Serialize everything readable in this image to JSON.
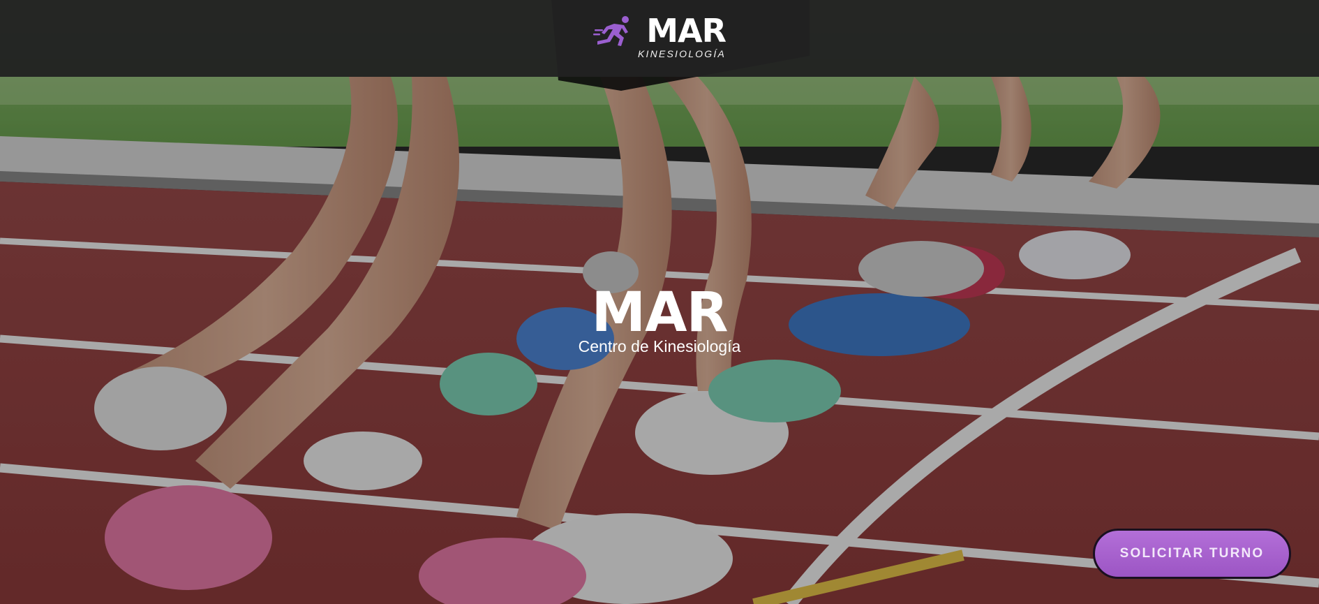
{
  "header": {
    "logo": {
      "icon": "runner-icon",
      "word": "MAR",
      "subtitle": "KINESIOLOGÍA",
      "accent_color": "#9b5fd0"
    }
  },
  "hero": {
    "background": "running-track-photo",
    "title": "MAR",
    "subtitle": "Centro de Kinesiología"
  },
  "cta": {
    "label": "SOLICITAR TURNO",
    "color": "#a862cf"
  }
}
